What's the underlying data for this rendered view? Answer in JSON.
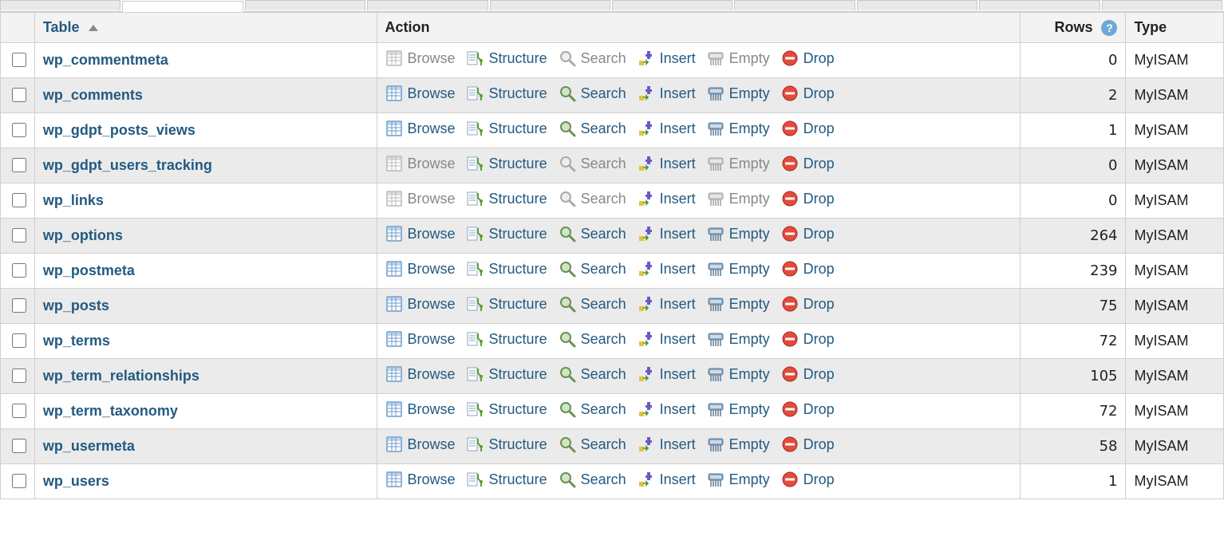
{
  "header": {
    "table": "Table",
    "action": "Action",
    "rows": "Rows",
    "type": "Type"
  },
  "actions": {
    "browse": "Browse",
    "structure": "Structure",
    "search": "Search",
    "insert": "Insert",
    "empty": "Empty",
    "drop": "Drop"
  },
  "tables": [
    {
      "name": "wp_commentmeta",
      "rows": "0",
      "type": "MyISAM",
      "browse_enabled": false,
      "search_enabled": false,
      "empty_enabled": false
    },
    {
      "name": "wp_comments",
      "rows": "2",
      "type": "MyISAM",
      "browse_enabled": true,
      "search_enabled": true,
      "empty_enabled": true
    },
    {
      "name": "wp_gdpt_posts_views",
      "rows": "1",
      "type": "MyISAM",
      "browse_enabled": true,
      "search_enabled": true,
      "empty_enabled": true
    },
    {
      "name": "wp_gdpt_users_tracking",
      "rows": "0",
      "type": "MyISAM",
      "browse_enabled": false,
      "search_enabled": false,
      "empty_enabled": false
    },
    {
      "name": "wp_links",
      "rows": "0",
      "type": "MyISAM",
      "browse_enabled": false,
      "search_enabled": false,
      "empty_enabled": false
    },
    {
      "name": "wp_options",
      "rows": "264",
      "type": "MyISAM",
      "browse_enabled": true,
      "search_enabled": true,
      "empty_enabled": true
    },
    {
      "name": "wp_postmeta",
      "rows": "239",
      "type": "MyISAM",
      "browse_enabled": true,
      "search_enabled": true,
      "empty_enabled": true
    },
    {
      "name": "wp_posts",
      "rows": "75",
      "type": "MyISAM",
      "browse_enabled": true,
      "search_enabled": true,
      "empty_enabled": true
    },
    {
      "name": "wp_terms",
      "rows": "72",
      "type": "MyISAM",
      "browse_enabled": true,
      "search_enabled": true,
      "empty_enabled": true
    },
    {
      "name": "wp_term_relationships",
      "rows": "105",
      "type": "MyISAM",
      "browse_enabled": true,
      "search_enabled": true,
      "empty_enabled": true
    },
    {
      "name": "wp_term_taxonomy",
      "rows": "72",
      "type": "MyISAM",
      "browse_enabled": true,
      "search_enabled": true,
      "empty_enabled": true
    },
    {
      "name": "wp_usermeta",
      "rows": "58",
      "type": "MyISAM",
      "browse_enabled": true,
      "search_enabled": true,
      "empty_enabled": true
    },
    {
      "name": "wp_users",
      "rows": "1",
      "type": "MyISAM",
      "browse_enabled": true,
      "search_enabled": true,
      "empty_enabled": true
    }
  ]
}
